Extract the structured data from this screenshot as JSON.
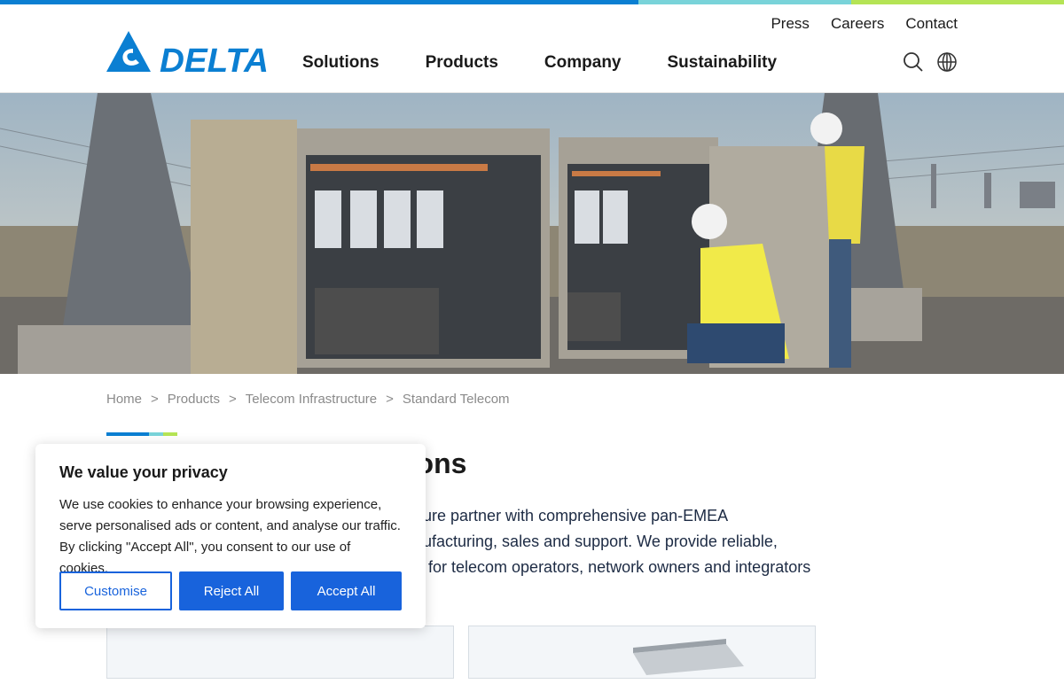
{
  "brand": {
    "name": "DELTA",
    "color": "#0b7fd2"
  },
  "utility_nav": [
    "Press",
    "Careers",
    "Contact"
  ],
  "main_nav": [
    "Solutions",
    "Products",
    "Company",
    "Sustainability"
  ],
  "icons": {
    "search": "search-icon",
    "language": "globe-icon"
  },
  "breadcrumb": [
    "Home",
    "Products",
    "Telecom Infrastructure",
    "Standard Telecom"
  ],
  "breadcrumb_separator": ">",
  "page": {
    "title_visible": "tions",
    "intro_lines": [
      "ucture partner with comprehensive pan-EMEA",
      "nufacturing, sales and support. We provide reliable,",
      "for telecom operators, network owners and integrators"
    ]
  },
  "cookie_banner": {
    "title": "We value your privacy",
    "body": "We use cookies to enhance your browsing experience, serve personalised ads or content, and analyse our traffic. By clicking \"Accept All\", you consent to our use of cookies.",
    "customise": "Customise",
    "reject": "Reject All",
    "accept": "Accept All",
    "button_color": "#1863dc"
  },
  "colors": {
    "stripe_blue": "#0b7fd2",
    "stripe_teal": "#79d3d9",
    "stripe_green": "#b5e455"
  }
}
